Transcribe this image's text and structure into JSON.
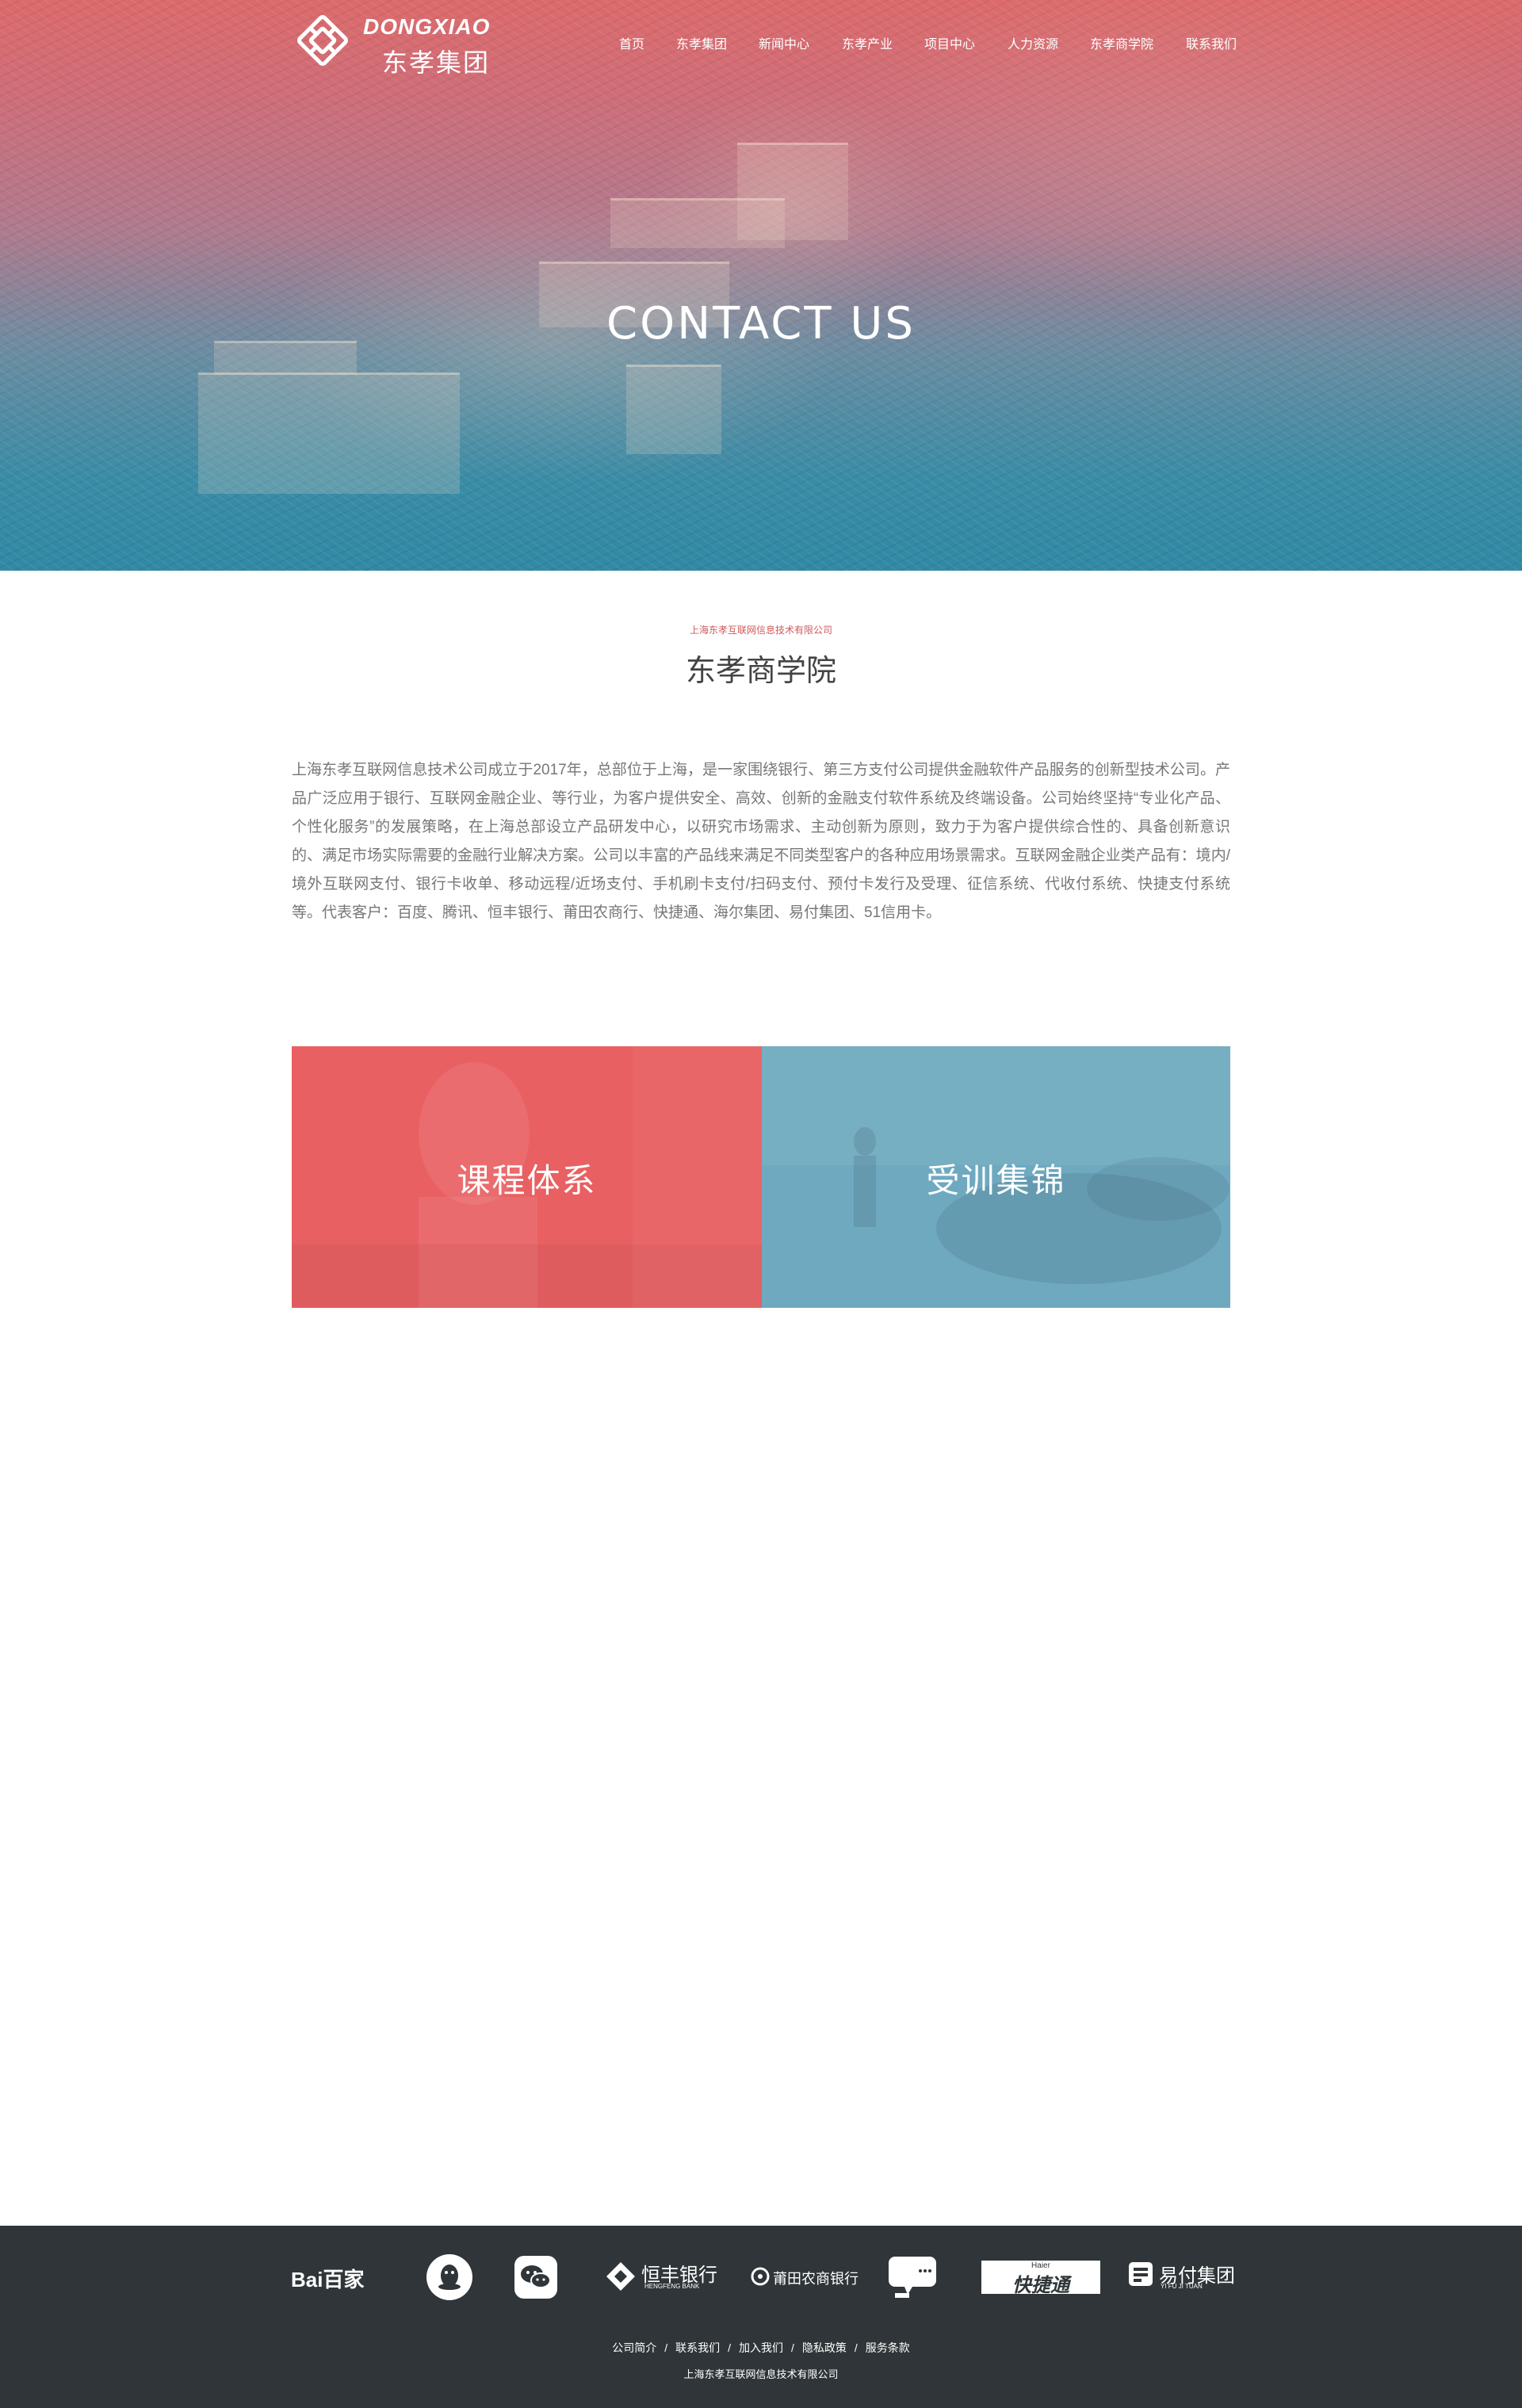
{
  "header": {
    "logo_en": "DONGXIAO",
    "logo_cn": "东孝集团",
    "nav": [
      "首页",
      "东孝集团",
      "新闻中心",
      "东孝产业",
      "项目中心",
      "人力资源",
      "东孝商学院",
      "联系我们"
    ]
  },
  "hero": {
    "title": "CONTACT US"
  },
  "about": {
    "subtitle": "上海东孝互联网信息技术有限公司",
    "title": "东孝商学院",
    "body": "上海东孝互联网信息技术公司成立于2017年，总部位于上海，是一家围绕银行、第三方支付公司提供金融软件产品服务的创新型技术公司。产品广泛应用于银行、互联网金融企业、等行业，为客户提供安全、高效、创新的金融支付软件系统及终端设备。公司始终坚持“专业化产品、个性化服务”的发展策略，在上海总部设立产品研发中心，以研究市场需求、主动创新为原则，致力于为客户提供综合性的、具备创新意识的、满足市场实际需要的金融行业解决方案。公司以丰富的产品线来满足不同类型客户的各种应用场景需求。互联网金融企业类产品有：境内/境外互联网支付、银行卡收单、移动远程/近场支付、手机刷卡支付/扫码支付、预付卡发行及受理、征信系统、代收付系统、快捷支付系统等。代表客户：百度、腾讯、恒丰银行、莆田农商行、快捷通、海尔集团、易付集团、51信用卡。"
  },
  "cards": {
    "left": "课程体系",
    "right": "受训集锦"
  },
  "footer": {
    "partners": {
      "baidu": "Bai百家",
      "hengfeng_cn": "恒丰银行",
      "hengfeng_en": "HENGFENG BANK",
      "putian": "莆田农商银行",
      "haier_small": "Haier",
      "kuaijietong": "快捷通",
      "yifu_cn": "易付集团",
      "yifu_en": "YI FU JI TUAN"
    },
    "links": [
      "公司简介",
      "联系我们",
      "加入我们",
      "隐私政策",
      "服务条款"
    ],
    "company": "上海东孝互联网信息技术有限公司"
  },
  "colors": {
    "hero_top": "#dc6a6b",
    "hero_bottom": "#3189a4",
    "card_left": "#e96062",
    "card_right": "#6ea9bf",
    "footer_bg": "#2f3538",
    "subtitle_accent": "#d05a5a"
  }
}
